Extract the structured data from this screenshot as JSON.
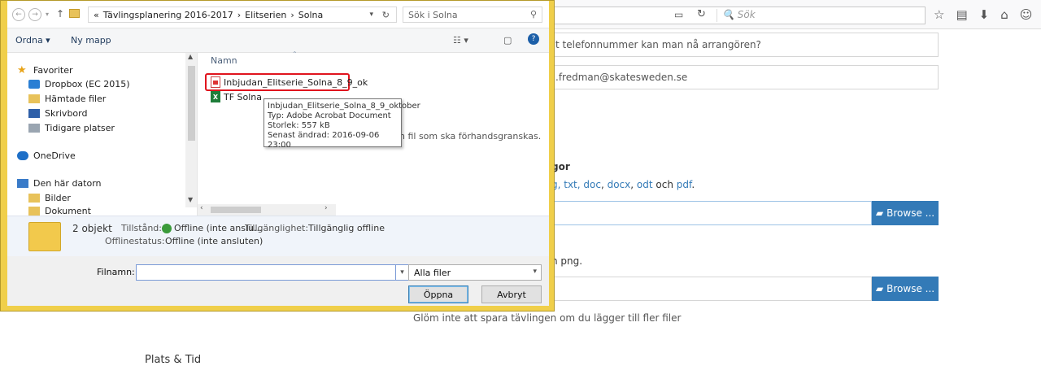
{
  "browser": {
    "search_placeholder": "Sök",
    "toolbar_icons": [
      "star-icon",
      "reading-list-icon",
      "download-icon",
      "home-icon",
      "account-icon"
    ]
  },
  "web": {
    "phone_placeholder": "t telefonnummer kan man nå arrangören?",
    "email_value": ".fredman@skatesweden.se",
    "section_heading": "gor",
    "formats_prefix": "g, txt, ",
    "formats_doc": "doc",
    "formats_docx": "docx",
    "formats_odt": "odt",
    "formats_och": "och",
    "formats_pdf": "pdf",
    "png_text": "n png.",
    "browse_label": "Browse ...",
    "save_reminder": "Glöm inte att spara tävlingen om du lägger till fler filer",
    "place_time": "Plats & Tid"
  },
  "dialog": {
    "path": [
      "Tävlingsplanering 2016-2017",
      "Elitserien",
      "Solna"
    ],
    "path_prefix": "«",
    "search_placeholder": "Sök i Solna",
    "organize": "Ordna ▾",
    "new_folder": "Ny mapp",
    "nav": [
      {
        "label": "Favoriter",
        "icon": "star-icon"
      },
      {
        "label": "Dropbox (EC 2015)",
        "icon": "dropbox-icon"
      },
      {
        "label": "Hämtade filer",
        "icon": "downloads-folder-icon"
      },
      {
        "label": "Skrivbord",
        "icon": "desktop-icon"
      },
      {
        "label": "Tidigare platser",
        "icon": "recent-places-icon"
      },
      {
        "label": "OneDrive",
        "icon": "onedrive-icon"
      },
      {
        "label": "Den här datorn",
        "icon": "computer-icon"
      },
      {
        "label": "Bilder",
        "icon": "pictures-folder-icon"
      },
      {
        "label": "Dokument",
        "icon": "documents-folder-icon"
      }
    ],
    "column_name": "Namn",
    "files": [
      {
        "name": "Inbjudan_Elitserie_Solna_8_9_ok",
        "icon": "pdf-icon"
      },
      {
        "name": "TF Solna",
        "icon": "excel-icon"
      }
    ],
    "preview_note": "n fil som ska förhandsgranskas.",
    "tooltip": {
      "line1": "Inbjudan_Elitserie_Solna_8_9_oktober",
      "line2": "Typ: Adobe Acrobat Document",
      "line3": "Storlek: 557 kB",
      "line4": "Senast ändrad: 2016-09-06 23:00"
    },
    "details": {
      "count": "2 objekt",
      "state_label": "Tillstånd:",
      "state_value": "Offline (inte anslu...",
      "availability_label": "Tillgänglighet:",
      "availability_value": "Tillgänglig offline",
      "offline_label": "Offlinestatus:",
      "offline_value": "Offline (inte ansluten)"
    },
    "filename_label": "Filnamn:",
    "filename_value": "",
    "filetype": "Alla filer",
    "open_button": "Öppna",
    "cancel_button": "Avbryt"
  }
}
